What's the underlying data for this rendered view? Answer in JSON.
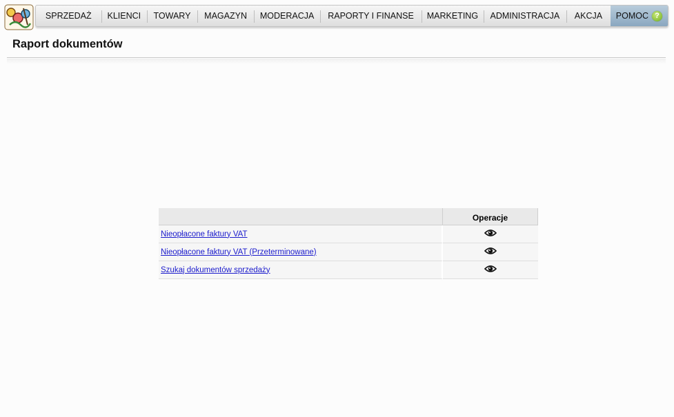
{
  "nav": {
    "logo_icon": "app-logo-icon",
    "items": [
      {
        "label": "SPRZEDAŻ"
      },
      {
        "label": "KLIENCI"
      },
      {
        "label": "TOWARY"
      },
      {
        "label": "MAGAZYN"
      },
      {
        "label": "MODERACJA"
      },
      {
        "label": "RAPORTY I FINANSE"
      },
      {
        "label": "MARKETING"
      },
      {
        "label": "ADMINISTRACJA"
      },
      {
        "label": "AKCJA"
      }
    ],
    "help_label": "POMOC",
    "help_icon": "question-mark-icon"
  },
  "page": {
    "title": "Raport dokumentów"
  },
  "table": {
    "headers": {
      "name": "",
      "operations": "Operacje"
    },
    "rows": [
      {
        "name": "Nieopłacone faktury VAT",
        "action_icon": "eye-icon"
      },
      {
        "name": "Nieopłacone faktury VAT (Przeterminowane)",
        "action_icon": "eye-icon"
      },
      {
        "name": "Szukaj dokumentów sprzedaży",
        "action_icon": "eye-icon"
      }
    ]
  },
  "colors": {
    "link": "#1a1acc",
    "help_bg": "#9fb8cd",
    "help_icon": "#7cbd26"
  }
}
